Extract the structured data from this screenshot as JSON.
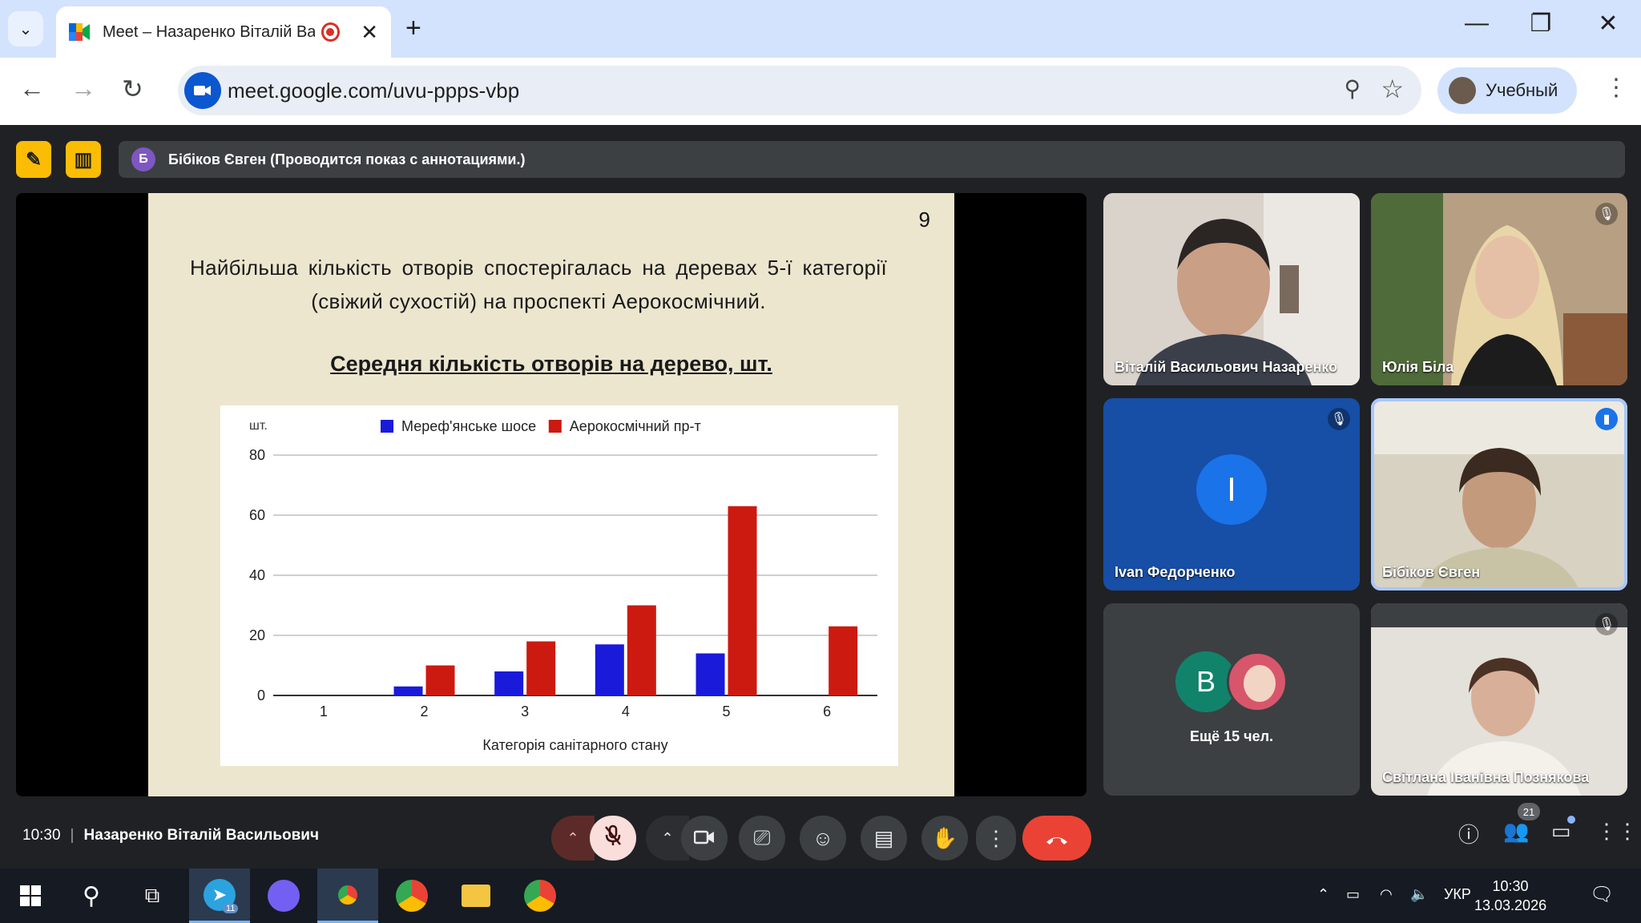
{
  "browser": {
    "tab_title": "Meet – Назаренко Віталій Вас",
    "url": "meet.google.com/uvu-ppps-vbp",
    "profile_name": "Учебный",
    "new_tab_symbol": "+",
    "tab_close_symbol": "✕"
  },
  "meet": {
    "presenter_initial": "Б",
    "presenter_banner": "Бібіков Євген (Проводится показ с аннотациями.)",
    "time": "10:30",
    "meeting_name": "Назаренко Віталій Васильович",
    "participants_badge": "21"
  },
  "slide": {
    "number": "9",
    "heading": "Найбільша кількість отворів спостерігалась на деревах 5-ї категорії (свіжий сухостій) на проспекті Аерокосмічний.",
    "chart_title": "Середня кількість отворів на дерево, шт."
  },
  "chart_data": {
    "type": "bar",
    "title": "Середня кількість отворів на дерево, шт.",
    "xlabel": "Категорія санітарного стану",
    "ylabel": "шт.",
    "categories": [
      "1",
      "2",
      "3",
      "4",
      "5",
      "6"
    ],
    "ylim": [
      0,
      80
    ],
    "yticks": [
      "0",
      "20",
      "40",
      "60",
      "80"
    ],
    "grid": true,
    "legend_position": "top",
    "series": [
      {
        "name": "Мереф'янське шосе",
        "color": "#1a1adb",
        "values": [
          0,
          3,
          8,
          17,
          14,
          0
        ]
      },
      {
        "name": "Аерокосмічний пр-т",
        "color": "#cc1a10",
        "values": [
          0,
          10,
          18,
          30,
          63,
          23
        ]
      }
    ]
  },
  "tiles": [
    {
      "name": "Віталій Васильович Назаренко",
      "muted": false
    },
    {
      "name": "Юлія Біла",
      "muted": true
    },
    {
      "name": "Ivan Федорченко",
      "initial": "I",
      "muted": true
    },
    {
      "name": "Бібіков Євген",
      "muted": false,
      "speaking": true
    },
    {
      "initial": "B",
      "more_label": "Ещё 15 чел."
    },
    {
      "name": "Світлана Іванівна Познякова",
      "muted": true
    }
  ],
  "taskbar": {
    "language": "УКР",
    "time": "10:30",
    "date": "13.03.2026",
    "telegram_badge": "11"
  },
  "colors": {
    "accent_blue": "#0b57d0",
    "end_call_red": "#ea4335",
    "presentation_yellow": "#fbbc04"
  }
}
